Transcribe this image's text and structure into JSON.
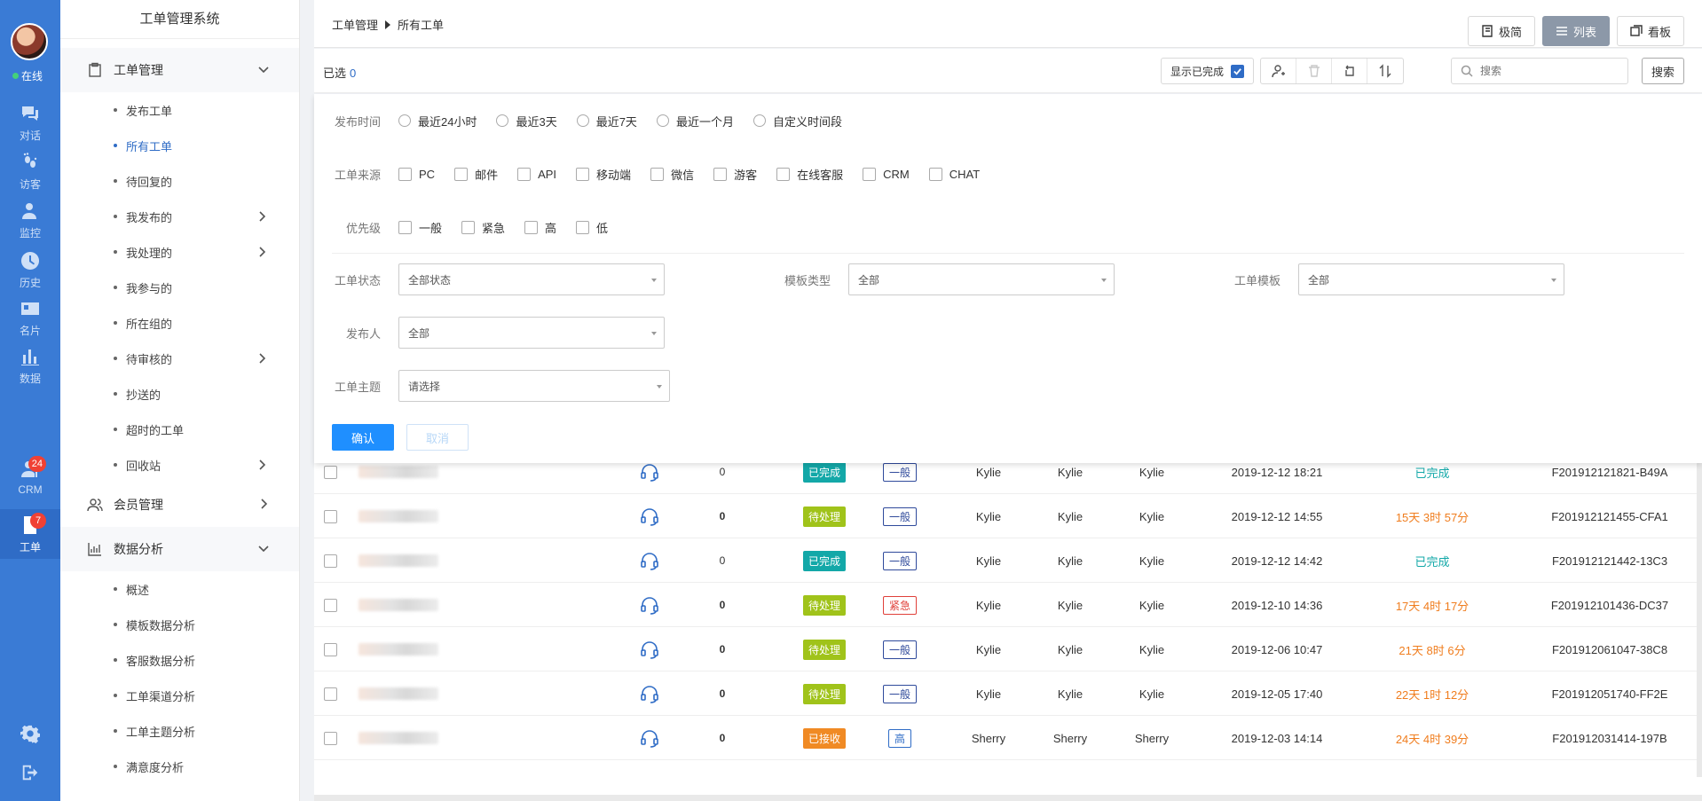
{
  "rail": {
    "status": "在线",
    "items": [
      {
        "label": "对话",
        "icon": "chat-icon"
      },
      {
        "label": "访客",
        "icon": "footprint-icon"
      },
      {
        "label": "监控",
        "icon": "monitor-icon"
      },
      {
        "label": "历史",
        "icon": "clock-icon"
      },
      {
        "label": "名片",
        "icon": "card-icon"
      },
      {
        "label": "数据",
        "icon": "bar-chart-icon"
      },
      {
        "label": "CRM",
        "icon": "crm-icon",
        "badge": "24"
      },
      {
        "label": "工单",
        "icon": "ticket-icon",
        "badge": "7"
      }
    ]
  },
  "sidenav": {
    "title": "工单管理系统",
    "group1": "工单管理",
    "items1": [
      "发布工单",
      "所有工单",
      "待回复的",
      "我发布的",
      "我处理的",
      "我参与的",
      "所在组的",
      "待审核的",
      "抄送的",
      "超时的工单",
      "回收站"
    ],
    "group2": "会员管理",
    "group3": "数据分析",
    "items3": [
      "概述",
      "模板数据分析",
      "客服数据分析",
      "工单渠道分析",
      "工单主题分析",
      "满意度分析"
    ]
  },
  "topbar": {
    "crumb1": "工单管理",
    "crumb2": "所有工单",
    "views": [
      "极简",
      "列表",
      "看板"
    ]
  },
  "toolbar": {
    "selected_label": "已选",
    "selected_count": "0",
    "show_done": "显示已完成",
    "search_placeholder": "搜索",
    "search_btn": "搜索"
  },
  "filter": {
    "time_label": "发布时间",
    "time_opts": [
      "最近24小时",
      "最近3天",
      "最近7天",
      "最近一个月",
      "自定义时间段"
    ],
    "source_label": "工单来源",
    "source_opts": [
      "PC",
      "邮件",
      "API",
      "移动端",
      "微信",
      "游客",
      "在线客服",
      "CRM",
      "CHAT"
    ],
    "prio_label": "优先级",
    "prio_opts": [
      "一般",
      "紧急",
      "高",
      "低"
    ],
    "status_label": "工单状态",
    "status_value": "全部状态",
    "tpltype_label": "模板类型",
    "tpltype_value": "全部",
    "tpl_label": "工单模板",
    "tpl_value": "全部",
    "publisher_label": "发布人",
    "publisher_value": "全部",
    "topic_label": "工单主题",
    "topic_value": "请选择",
    "ok": "确认",
    "cancel": "取消"
  },
  "colors": {
    "done": "#13a8a8",
    "pending": "#a0c31a",
    "received": "#f08a24",
    "urgent": "#e0403a",
    "remain": "#f07d1e"
  },
  "rows": [
    {
      "count": "0",
      "status": "已完成",
      "prio": "一般",
      "u1": "Kylie",
      "u2": "Kylie",
      "u3": "Kylie",
      "time": "2019-12-12 18:21",
      "remain": "已完成",
      "id": "F201912121821-B49A"
    },
    {
      "count": "0",
      "status": "待处理",
      "prio": "一般",
      "u1": "Kylie",
      "u2": "Kylie",
      "u3": "Kylie",
      "time": "2019-12-12 14:55",
      "remain": "15天 3时 57分",
      "id": "F201912121455-CFA1"
    },
    {
      "count": "0",
      "status": "已完成",
      "prio": "一般",
      "u1": "Kylie",
      "u2": "Kylie",
      "u3": "Kylie",
      "time": "2019-12-12 14:42",
      "remain": "已完成",
      "id": "F201912121442-13C3"
    },
    {
      "count": "0",
      "status": "待处理",
      "prio": "紧急",
      "u1": "Kylie",
      "u2": "Kylie",
      "u3": "Kylie",
      "time": "2019-12-10 14:36",
      "remain": "17天 4时 17分",
      "id": "F201912101436-DC37"
    },
    {
      "count": "0",
      "status": "待处理",
      "prio": "一般",
      "u1": "Kylie",
      "u2": "Kylie",
      "u3": "Kylie",
      "time": "2019-12-06 10:47",
      "remain": "21天 8时 6分",
      "id": "F201912061047-38C8"
    },
    {
      "count": "0",
      "status": "待处理",
      "prio": "一般",
      "u1": "Kylie",
      "u2": "Kylie",
      "u3": "Kylie",
      "time": "2019-12-05 17:40",
      "remain": "22天 1时 12分",
      "id": "F201912051740-FF2E"
    },
    {
      "count": "0",
      "status": "已接收",
      "prio": "高",
      "u1": "Sherry",
      "u2": "Sherry",
      "u3": "Sherry",
      "time": "2019-12-03 14:14",
      "remain": "24天 4时 39分",
      "id": "F201912031414-197B"
    }
  ]
}
